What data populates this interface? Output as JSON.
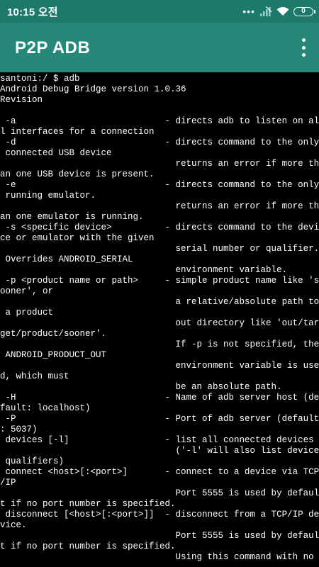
{
  "status_bar": {
    "time": "10:15 오전",
    "battery": "0",
    "icons": [
      "more-dots-icon",
      "signal-icon",
      "wifi-icon",
      "battery-icon"
    ]
  },
  "app_bar": {
    "title": "P2P ADB",
    "menu_icon": "overflow-menu-icon"
  },
  "colors": {
    "status_bar": "#1d7a6b",
    "app_bar": "#258878",
    "terminal_bg": "#000000",
    "terminal_text": "#ffffff"
  },
  "terminal": {
    "lines": [
      "santoni:/ $ adb",
      "Android Debug Bridge version 1.0.36",
      "Revision",
      "",
      " -a                            - directs adb to listen on al",
      "l interfaces for a connection",
      " -d                            - directs command to the only",
      " connected USB device",
      "                                 returns an error if more th",
      "an one USB device is present.",
      " -e                            - directs command to the only",
      " running emulator.",
      "                                 returns an error if more th",
      "an one emulator is running.",
      " -s <specific device>          - directs command to the devi",
      "ce or emulator with the given",
      "                                 serial number or qualifier.",
      " Overrides ANDROID_SERIAL",
      "                                 environment variable.",
      " -p <product name or path>     - simple product name like 's",
      "ooner', or",
      "                                 a relative/absolute path to",
      " a product",
      "                                 out directory like 'out/tar",
      "get/product/sooner'.",
      "                                 If -p is not specified, the",
      " ANDROID_PRODUCT_OUT",
      "                                 environment variable is use",
      "d, which must",
      "                                 be an absolute path.",
      " -H                            - Name of adb server host (de",
      "fault: localhost)",
      " -P                            - Port of adb server (default",
      ": 5037)",
      " devices [-l]                  - list all connected devices",
      "                                 ('-l' will also list device",
      " qualifiers)",
      " connect <host>[:<port>]       - connect to a device via TCP",
      "/IP",
      "                                 Port 5555 is used by defaul",
      "t if no port number is specified.",
      " disconnect [<host>[:<port>]]  - disconnect from a TCP/IP de",
      "vice.",
      "                                 Port 5555 is used by defaul",
      "t if no port number is specified.",
      "                                 Using this command with no"
    ]
  }
}
